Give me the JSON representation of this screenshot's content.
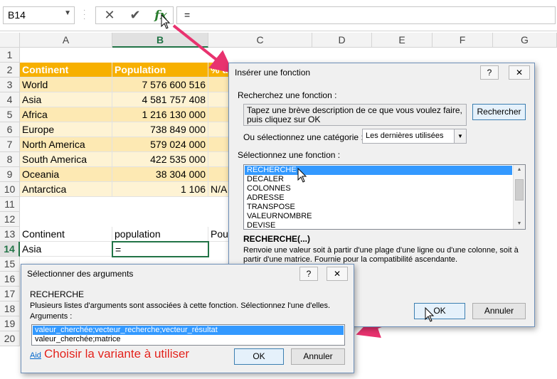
{
  "formula_bar": {
    "name_box": "B14",
    "cancel_icon": "✕",
    "enter_icon": "✔",
    "fx_label": "fx",
    "formula": "="
  },
  "columns": [
    "A",
    "B",
    "C",
    "D",
    "E",
    "F",
    "G"
  ],
  "rows": [
    "1",
    "2",
    "3",
    "4",
    "5",
    "6",
    "7",
    "8",
    "9",
    "10",
    "11",
    "12",
    "13",
    "14",
    "15",
    "16",
    "17",
    "18",
    "19",
    "20"
  ],
  "table": {
    "headers": [
      "Continent",
      "Population",
      "% d"
    ],
    "rows": [
      [
        "World",
        "7 576 600 516"
      ],
      [
        "Asia",
        "4 581 757 408"
      ],
      [
        "Africa",
        "1 216 130 000"
      ],
      [
        "Europe",
        "738 849 000"
      ],
      [
        "North America",
        "579 024 000"
      ],
      [
        "South America",
        "422 535 000"
      ],
      [
        "Oceania",
        "38 304 000"
      ],
      [
        "Antarctica",
        "1 106"
      ]
    ],
    "antarctica_c": "N/A"
  },
  "lookup": {
    "h_continent": "Continent",
    "h_population": "population",
    "h_c": "Pou",
    "continent": "Asia",
    "population": "="
  },
  "insert_function": {
    "title": "Insérer une fonction",
    "help": "?",
    "close": "✕",
    "search_label": "Recherchez une fonction :",
    "search_text": "Tapez une brève description de ce que vous voulez faire, puis cliquez sur OK",
    "search_button": "Rechercher",
    "category_label": "Ou sélectionnez une catégorie :",
    "category_value": "Les dernières utilisées",
    "select_label": "Sélectionnez une fonction :",
    "functions": [
      "RECHERCHE",
      "DECALER",
      "COLONNES",
      "ADRESSE",
      "TRANSPOSE",
      "VALEURNOMBRE",
      "DEVISE"
    ],
    "signature": "RECHERCHE(...)",
    "description": "Renvoie une valeur soit à partir d'une plage d'une ligne ou d'une colonne, soit à partir d'une matrice. Fournie pour la compatibilité ascendante.",
    "ok": "OK",
    "cancel": "Annuler"
  },
  "select_args": {
    "title": "Sélectionner des arguments",
    "help": "?",
    "close": "✕",
    "function_name": "RECHERCHE",
    "info": "Plusieurs listes d'arguments sont associées à cette fonction. Sélectionnez l'une d'elles.",
    "args_label": "Arguments :",
    "options": [
      "valeur_cherchée;vecteur_recherche;vecteur_résultat",
      "valeur_cherchée;matrice"
    ],
    "help_link": "Aid",
    "ok": "OK",
    "cancel": "Annuler"
  },
  "annotation": "Choisir la variante à utiliser",
  "colors": {
    "header_orange": "#f7b000",
    "row_light": "#fde9b3",
    "row_lighter": "#fef3d4",
    "excel_green": "#217346",
    "arrow_pink": "#e8336f",
    "annotation_red": "#e0201a"
  }
}
